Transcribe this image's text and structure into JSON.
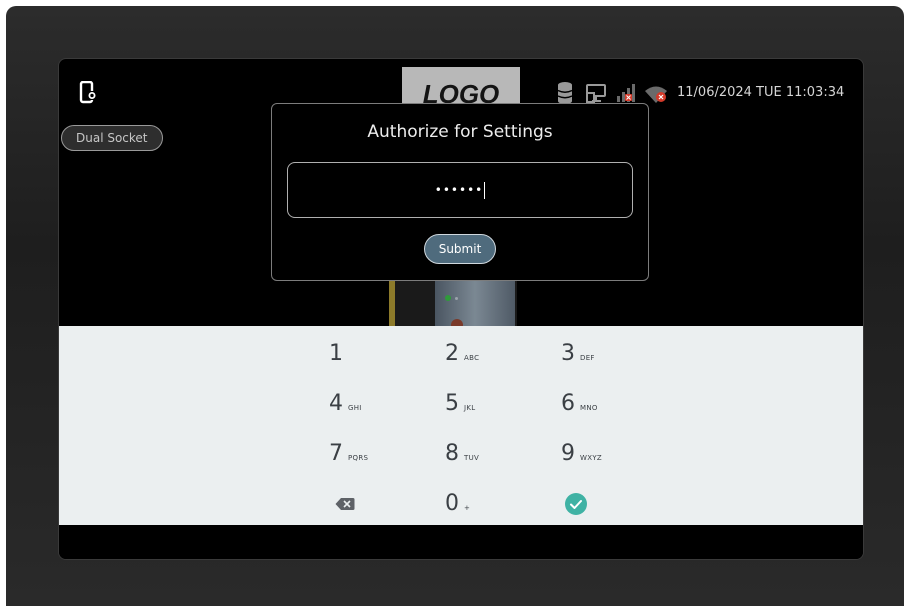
{
  "header": {
    "logo_text": "LOGO",
    "datetime": "11/06/2024 TUE 11:03:34",
    "icons": [
      "device-settings-icon",
      "database-icon",
      "network-icon",
      "signal-bars-icon",
      "wifi-off-icon"
    ]
  },
  "socket_selector": {
    "label": "Dual Socket"
  },
  "dialog": {
    "title": "Authorize for Settings",
    "password_value": "••••••",
    "submit_label": "Submit"
  },
  "keypad": {
    "keys": [
      {
        "digit": "1",
        "letters": ""
      },
      {
        "digit": "2",
        "letters": "ABC"
      },
      {
        "digit": "3",
        "letters": "DEF"
      },
      {
        "digit": "4",
        "letters": "GHI"
      },
      {
        "digit": "5",
        "letters": "JKL"
      },
      {
        "digit": "6",
        "letters": "MNO"
      },
      {
        "digit": "7",
        "letters": "PQRS"
      },
      {
        "digit": "8",
        "letters": "TUV"
      },
      {
        "digit": "9",
        "letters": "WXYZ"
      },
      {
        "digit": "0",
        "letters": "+"
      }
    ],
    "backspace_icon": "backspace-icon",
    "confirm_icon": "checkmark-icon"
  },
  "colors": {
    "keypad_bg": "#ebeff0",
    "submit_bg": "#4f6b7d",
    "confirm": "#3fb2a4",
    "alert_red": "#d43a2a"
  }
}
